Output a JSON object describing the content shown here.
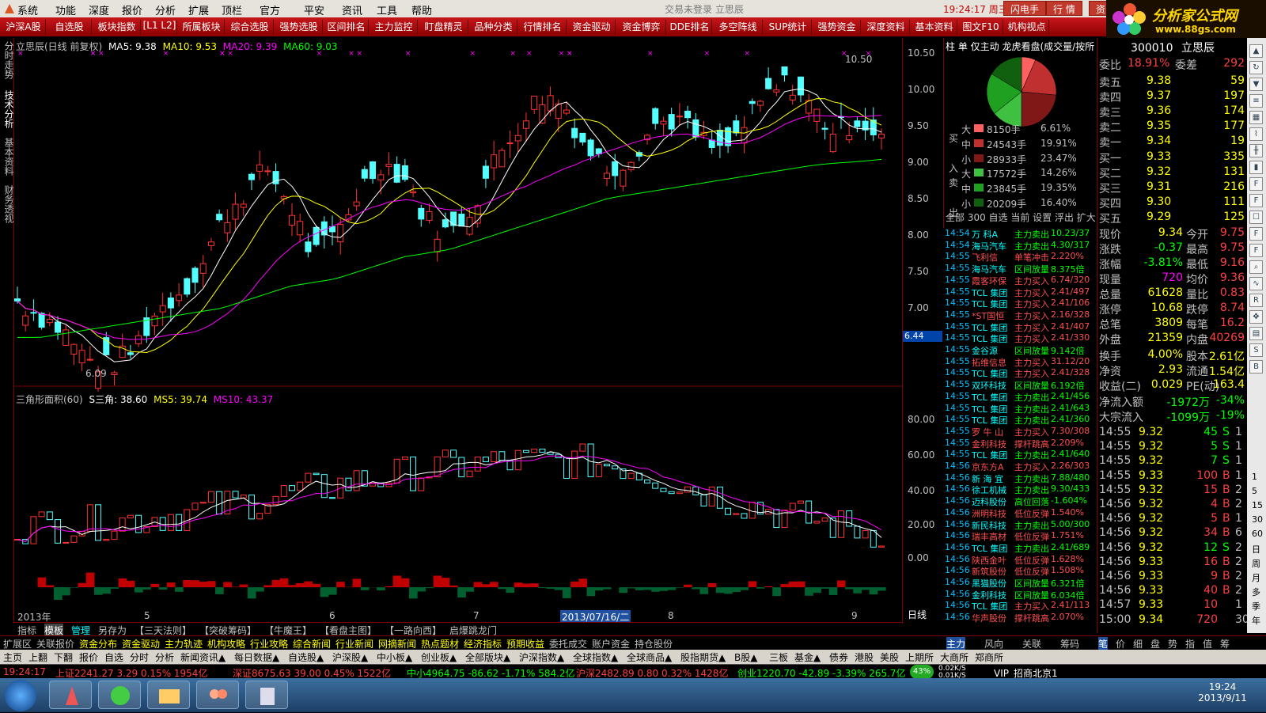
{
  "menubar": {
    "items": [
      "系统",
      "功能",
      "深度",
      "报价",
      "分析",
      "扩展",
      "顶栏",
      "官方",
      "平安",
      "资讯",
      "工具",
      "帮助"
    ],
    "center_text": "交易未登录    立思辰",
    "clock": "19:24:17 周三",
    "buttons": [
      "闪电手",
      "行 情",
      "资"
    ]
  },
  "toolbar": {
    "items": [
      "沪深A股",
      "自选股",
      "板块指数",
      "[L1 L2]",
      "所属板块",
      "综合选股",
      "强势选股",
      "区间排名",
      "主力监控",
      "盯盘精灵",
      "品种分类",
      "行情排名",
      "资金驱动",
      "资金博弈",
      "DDE排名",
      "多空阵线",
      "SUP统计",
      "强势资金",
      "深度资料",
      "基本资料",
      "图文F10",
      "机构视点"
    ]
  },
  "logo": {
    "line1": "分析家公式网",
    "line2": "www.88gs.com"
  },
  "left_tabs": [
    "分时走势",
    "技术分析",
    "基本资料",
    "财务透视"
  ],
  "main_chart": {
    "title": "立思辰(日线 前复权)",
    "ma5_label": "MA5: 9.38",
    "ma10_label": "MA10: 9.53",
    "ma20_label": "MA20: 9.39",
    "ma60_label": "MA60: 9.03",
    "high_label": "10.50",
    "low_label": "6.09",
    "current_marker": "6.44",
    "y_ticks": [
      "10.50",
      "10.00",
      "9.50",
      "9.00",
      "8.50",
      "8.00",
      "7.50",
      "7.00"
    ],
    "period_label": "日线"
  },
  "sub_chart": {
    "title": "三角形面积(60)",
    "s_label": "S三角: 38.60",
    "ms5_label": "MS5: 39.74",
    "ms10_label": "MS10: 43.37",
    "y_ticks": [
      "80.00",
      "60.00",
      "40.00",
      "20.00",
      "0.00"
    ]
  },
  "x_axis": {
    "labels": [
      "2013年",
      "5",
      "6",
      "7",
      "2013/07/16/二",
      "8",
      "9"
    ]
  },
  "chart_data": {
    "type": "line",
    "title": "立思辰(日线 前复权)",
    "ylim": [
      6.0,
      10.6
    ],
    "ma": {
      "MA5": 9.38,
      "MA10": 9.53,
      "MA20": 9.39,
      "MA60": 9.03
    },
    "x": [
      "2013年",
      "5",
      "6",
      "7",
      "8",
      "9"
    ],
    "series": [
      {
        "name": "close",
        "values": [
          7.1,
          6.9,
          6.7,
          6.3,
          6.2,
          6.4,
          6.9,
          7.2,
          7.5,
          8.2,
          8.6,
          8.9,
          8.4,
          7.7,
          8.0,
          8.6,
          9.0,
          8.8,
          8.2,
          8.0,
          8.4,
          9.0,
          9.5,
          9.9,
          9.8,
          9.2,
          8.9,
          9.1,
          9.5,
          9.6,
          9.3,
          9.1,
          9.5,
          9.9,
          10.1,
          9.7,
          9.4,
          9.6,
          9.34
        ]
      },
      {
        "name": "MA60",
        "values": [
          6.6,
          6.6,
          6.65,
          6.7,
          6.75,
          6.8,
          6.85,
          6.9,
          6.95,
          7.0,
          7.1,
          7.2,
          7.3,
          7.35,
          7.4,
          7.5,
          7.6,
          7.7,
          7.75,
          7.8,
          7.9,
          8.0,
          8.1,
          8.2,
          8.3,
          8.4,
          8.5,
          8.55,
          8.6,
          8.65,
          8.7,
          8.75,
          8.8,
          8.85,
          8.9,
          8.95,
          8.98,
          9.0,
          9.03
        ]
      }
    ],
    "sub_indicator": {
      "name": "三角形面积(60)",
      "ylim": [
        -10,
        92
      ],
      "S三角": 38.6,
      "MS5": 39.74,
      "MS10": 43.37
    }
  },
  "bottom_tabs1": [
    "指标",
    "模板",
    "管理",
    "另存为",
    "【三天法则】",
    "【突破筹码】",
    "【牛魔王】",
    "【看盘主图】",
    "【一路向西】",
    "启爆跳龙门"
  ],
  "bottom_tabs2": [
    "扩展区",
    "关联报价",
    "资金分布",
    "资金驱动",
    "主力轨迹",
    "机构攻略",
    "行业攻略",
    "综合新闻",
    "行业新闻",
    "网摘新闻",
    "热点题材",
    "经济指标",
    "预期收益",
    "委托成交",
    "账户资金",
    "持仓股份"
  ],
  "bottom_tabs2_right": [
    "主力",
    "风向",
    "关联",
    "筹码",
    "笔",
    "价",
    "细",
    "盘",
    "势",
    "指",
    "值",
    "筹"
  ],
  "bottom_tabs3": [
    "主页",
    "上翻",
    "下翻",
    "报价",
    "自选",
    "分时",
    "分析",
    "新闻资讯▲",
    "每日数据▲",
    "自选股▲",
    "沪深股▲",
    "中小板▲",
    "创业板▲",
    "全部版块▲",
    "沪深指数▲",
    "全球指数▲",
    "全球商品▲",
    "股指期货▲",
    "B股▲",
    "三板",
    "基金▲",
    "债券",
    "港股",
    "美股",
    "上期所",
    "大商所",
    "郑商所"
  ],
  "index_bar": {
    "time": "19:24:17",
    "sh": "上证2241.27  3.29  0.15%  1954亿",
    "sz": "深证8675.63  39.00  0.45%  1522亿",
    "zx": "中小4964.75  -86.62  -1.71%  584.2亿",
    "hs": "沪深2482.89  0.80  0.32%  1428亿",
    "cy": "创业1220.70  -42.89  -3.39%  265.7亿",
    "net": "43%",
    "speed_up": "0.02K/S",
    "speed_down": "0.01K/S",
    "vip": "VIP_招商北京1"
  },
  "pie_panel": {
    "header": "柱 单 仅主动 龙虎看盘(成交量/按所",
    "buy": [
      {
        "size": "大",
        "qty": "8150手",
        "pct": "6.61%"
      },
      {
        "size": "中",
        "qty": "24543手",
        "pct": "19.91%"
      },
      {
        "size": "小",
        "qty": "28933手",
        "pct": "23.47%"
      }
    ],
    "sell": [
      {
        "size": "大",
        "qty": "17572手",
        "pct": "14.26%"
      },
      {
        "size": "中",
        "qty": "23845手",
        "pct": "19.35%"
      },
      {
        "size": "小",
        "qty": "20209手",
        "pct": "16.40%"
      }
    ],
    "buy_side": "买入",
    "sell_side": "卖出",
    "footer": "全部 300 自选 当前 设置 浮出 扩大"
  },
  "news": [
    [
      "14:54",
      "万 科A",
      "主力卖出",
      "10.23/37"
    ],
    [
      "14:54",
      "海马汽车",
      "主力卖出",
      "4.30/317"
    ],
    [
      "14:55",
      "飞利信",
      "单笔冲击",
      "2.220%"
    ],
    [
      "14:55",
      "海马汽车",
      "区间放量",
      "8.375倍"
    ],
    [
      "14:55",
      "霞客环保",
      "主力买入",
      "6.74/320"
    ],
    [
      "14:55",
      "TCL 集团",
      "主力买入",
      "2.41/497"
    ],
    [
      "14:55",
      "TCL 集团",
      "主力买入",
      "2.41/106"
    ],
    [
      "14:55",
      "*ST国恒",
      "主力买入",
      "2.16/328"
    ],
    [
      "14:55",
      "TCL 集团",
      "主力买入",
      "2.41/407"
    ],
    [
      "14:55",
      "TCL 集团",
      "主力买入",
      "2.41/330"
    ],
    [
      "14:55",
      "金谷源",
      "区间放量",
      "9.142倍"
    ],
    [
      "14:55",
      "拓维信息",
      "主力买入",
      "31.12/20"
    ],
    [
      "14:55",
      "TCL 集团",
      "主力买入",
      "2.41/328"
    ],
    [
      "14:55",
      "双环科技",
      "区间放量",
      "6.192倍"
    ],
    [
      "14:55",
      "TCL 集团",
      "主力卖出",
      "2.41/456"
    ],
    [
      "14:55",
      "TCL 集团",
      "主力卖出",
      "2.41/643"
    ],
    [
      "14:55",
      "TCL 集团",
      "主力卖出",
      "2.41/360"
    ],
    [
      "14:55",
      "罗 牛 山",
      "主力买入",
      "7.30/308"
    ],
    [
      "14:55",
      "金利科技",
      "撑杆跳高",
      "2.209%"
    ],
    [
      "14:55",
      "TCL 集团",
      "主力卖出",
      "2.41/640"
    ],
    [
      "14:56",
      "京东方A",
      "主力买入",
      "2.26/303"
    ],
    [
      "14:56",
      "新 海 宜",
      "主力卖出",
      "7.88/480"
    ],
    [
      "14:56",
      "徐工机械",
      "主力卖出",
      "9.30/433"
    ],
    [
      "14:56",
      "迈科股份",
      "高位回落",
      "-1.604%"
    ],
    [
      "14:56",
      "洲明科技",
      "低位反弹",
      "1.540%"
    ],
    [
      "14:56",
      "新民科技",
      "主力卖出",
      "5.00/300"
    ],
    [
      "14:56",
      "瑞丰高材",
      "低位反弹",
      "1.751%"
    ],
    [
      "14:56",
      "TCL 集团",
      "主力卖出",
      "2.41/689"
    ],
    [
      "14:56",
      "陕西金叶",
      "低位反弹",
      "1.628%"
    ],
    [
      "14:56",
      "新筑股份",
      "低位反弹",
      "1.508%"
    ],
    [
      "14:56",
      "黑猫股份",
      "区间放量",
      "6.321倍"
    ],
    [
      "14:56",
      "金利科技",
      "区间放量",
      "6.034倍"
    ],
    [
      "14:56",
      "TCL 集团",
      "主力买入",
      "2.41/113"
    ],
    [
      "14:56",
      "华声股份",
      "撑杆跳高",
      "2.070%"
    ]
  ],
  "quote": {
    "code": "300010",
    "name": "立思辰",
    "weibi_label": "委比",
    "weibi": "18.91%",
    "weicha_label": "委差",
    "weicha": "292",
    "asks": [
      [
        "卖五",
        "9.38",
        "59"
      ],
      [
        "卖四",
        "9.37",
        "197"
      ],
      [
        "卖三",
        "9.36",
        "174"
      ],
      [
        "卖二",
        "9.35",
        "177"
      ],
      [
        "卖一",
        "9.34",
        "19"
      ]
    ],
    "bids": [
      [
        "买一",
        "9.33",
        "335"
      ],
      [
        "买二",
        "9.32",
        "131"
      ],
      [
        "买三",
        "9.31",
        "216"
      ],
      [
        "买四",
        "9.30",
        "111"
      ],
      [
        "买五",
        "9.29",
        "125"
      ]
    ],
    "stats": [
      [
        "现价",
        "9.34",
        "今开",
        "9.75"
      ],
      [
        "涨跌",
        "-0.37",
        "最高",
        "9.75"
      ],
      [
        "涨幅",
        "-3.81%",
        "最低",
        "9.16"
      ],
      [
        "现量",
        "720",
        "均价",
        "9.36"
      ],
      [
        "总量",
        "61628",
        "量比",
        "0.83"
      ],
      [
        "涨停",
        "10.68",
        "跌停",
        "8.74"
      ],
      [
        "总笔",
        "3809",
        "每笔",
        "16.2"
      ],
      [
        "外盘",
        "21359",
        "内盘",
        "40269"
      ]
    ],
    "fund": [
      [
        "换手",
        "4.00%",
        "股本",
        "2.61亿"
      ],
      [
        "净资",
        "2.93",
        "流通",
        "1.54亿"
      ],
      [
        "收益(二)",
        "0.029",
        "PE(动)",
        "163.4"
      ]
    ],
    "flows": [
      [
        "净流入额",
        "-1972万",
        "-34%"
      ],
      [
        "大宗流入",
        "-1099万",
        "-19%"
      ]
    ],
    "ticks": [
      [
        "14:55",
        "9.32",
        "45",
        "S",
        "1"
      ],
      [
        "14:55",
        "9.32",
        "5",
        "S",
        "1"
      ],
      [
        "14:55",
        "9.32",
        "7",
        "S",
        "1"
      ],
      [
        "14:55",
        "9.33",
        "100",
        "B",
        "1"
      ],
      [
        "14:55",
        "9.32",
        "15",
        "B",
        "2"
      ],
      [
        "14:56",
        "9.32",
        "4",
        "B",
        "2"
      ],
      [
        "14:56",
        "9.32",
        "5",
        "B",
        "1"
      ],
      [
        "14:56",
        "9.32",
        "34",
        "B",
        "6"
      ],
      [
        "14:56",
        "9.32",
        "12",
        "S",
        "2"
      ],
      [
        "14:56",
        "9.33",
        "16",
        "B",
        "2"
      ],
      [
        "14:56",
        "9.33",
        "9",
        "B",
        "2"
      ],
      [
        "14:56",
        "9.33",
        "40",
        "B",
        "2"
      ],
      [
        "14:57",
        "9.33",
        "10",
        "",
        "1"
      ],
      [
        "15:00",
        "9.34",
        "720",
        "",
        "30"
      ]
    ]
  },
  "side_icons": [
    "up-arrow-icon",
    "refresh-icon",
    "down-arrow-icon",
    "list-icon",
    "grid-icon",
    "line-chart-icon",
    "kline-icon",
    "bars-icon",
    "f10-icon",
    "f11-icon",
    "doc-icon",
    "f9-icon",
    "fa-icon",
    "search-icon",
    "wave-icon",
    "rsi-icon",
    "compass-icon",
    "stack-icon",
    "s-icon",
    "b-icon"
  ],
  "side_numbers": [
    "1",
    "5",
    "15",
    "30",
    "60",
    "日",
    "周",
    "月",
    "多",
    "季",
    "年"
  ],
  "taskbar": {
    "time": "19:24",
    "date": "2013/9/11"
  },
  "colors": {
    "up": "#ff3232",
    "down": "#54ffff",
    "ma5": "#ffffff",
    "ma10": "#ffff00",
    "ma20": "#ff00ff",
    "ma60": "#00ff00",
    "frame": "#800000"
  }
}
